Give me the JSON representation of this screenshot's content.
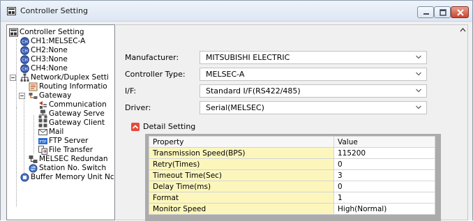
{
  "window": {
    "title": "Controller Setting",
    "icon": "controller-setting-icon",
    "buttons": [
      "minimize-icon",
      "maximize-icon",
      "close-icon"
    ]
  },
  "tree": {
    "items": [
      {
        "label": "Controller Setting",
        "icon": "controller-setting-icon"
      },
      {
        "label": "CH1:MELSEC-A",
        "icon": "channel-icon",
        "selected": true
      },
      {
        "label": "CH2:None",
        "icon": "channel-icon"
      },
      {
        "label": "CH3:None",
        "icon": "channel-icon"
      },
      {
        "label": "CH4:None",
        "icon": "channel-icon"
      },
      {
        "label": "Network/Duplex Setti",
        "icon": "network-icon"
      },
      {
        "label": "Routing Informatio",
        "icon": "routing-icon"
      },
      {
        "label": "Gateway",
        "icon": "gateway-icon"
      },
      {
        "label": "Communication",
        "icon": "communication-icon"
      },
      {
        "label": "Gateway Serve",
        "icon": "gateway-server-icon"
      },
      {
        "label": "Gateway Client",
        "icon": "gateway-client-icon"
      },
      {
        "label": "Mail",
        "icon": "mail-icon"
      },
      {
        "label": "FTP Server",
        "icon": "ftp-server-icon",
        "badge": "FTP"
      },
      {
        "label": "File Transfer",
        "icon": "file-transfer-icon"
      },
      {
        "label": "MELSEC Redundan",
        "icon": "redundant-icon"
      },
      {
        "label": "Station No. Switch",
        "icon": "station-switch-icon"
      },
      {
        "label": "Buffer Memory Unit Nc",
        "icon": "buffer-memory-icon"
      }
    ]
  },
  "form": {
    "manufacturer_label": "Manufacturer:",
    "manufacturer_value": "MITSUBISHI ELECTRIC",
    "controller_type_label": "Controller Type:",
    "controller_type_value": "MELSEC-A",
    "if_label": "I/F:",
    "if_value": "Standard I/F(RS422/485)",
    "driver_label": "Driver:",
    "driver_value": "Serial(MELSEC)"
  },
  "detail": {
    "label": "Detail Setting",
    "toggle_color": "#e84a3a",
    "columns": [
      "Property",
      "Value"
    ],
    "rows": [
      {
        "property": "Transmission Speed(BPS)",
        "value": "115200"
      },
      {
        "property": "Retry(Times)",
        "value": "0"
      },
      {
        "property": "Timeout Time(Sec)",
        "value": "3"
      },
      {
        "property": "Delay Time(ms)",
        "value": "0"
      },
      {
        "property": "Format",
        "value": "1"
      },
      {
        "property": "Monitor Speed",
        "value": "High(Normal)"
      }
    ]
  },
  "colors": {
    "property_cell_bg": "#fcf6bd",
    "grid_backdrop": "#ababab"
  }
}
